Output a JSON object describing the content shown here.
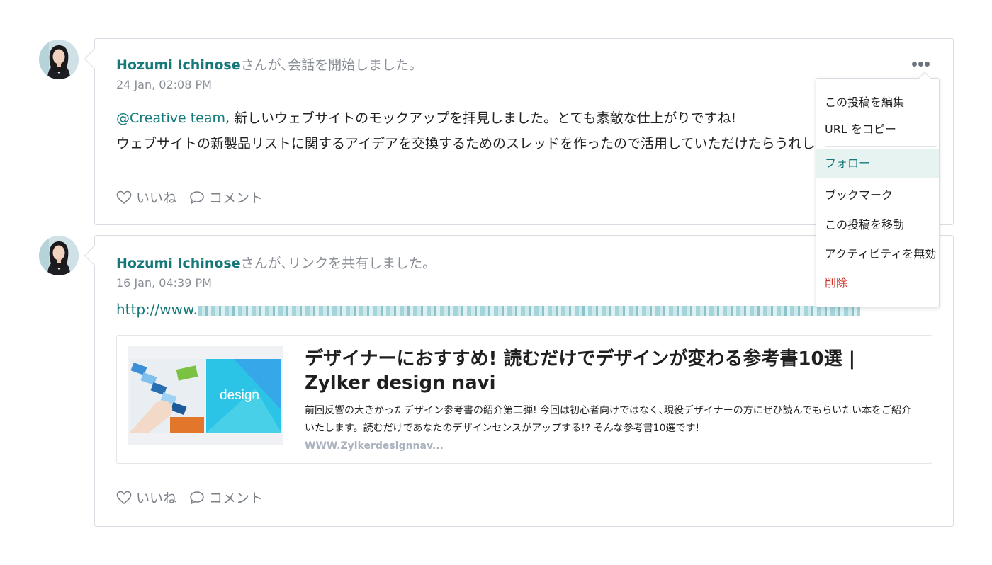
{
  "posts": [
    {
      "author": "Hozumi Ichinose",
      "action": "さんが､会話を開始しました。",
      "time": "24 Jan, 02:08 PM",
      "mention": "@Creative team",
      "line1": ", 新しいウェブサイトのモックアップを拝見しました。とても素敵な仕上がりですね!",
      "line2": "ウェブサイトの新製品リストに関するアイデアを交換するためのスレッドを作ったので活用していただけたらうれしいです。",
      "like_label": "いいね",
      "comment_label": "コメント"
    },
    {
      "author": "Hozumi Ichinose",
      "action": "さんが､リンクを共有しました。",
      "time": "16 Jan, 04:39 PM",
      "link_prefix": "http://www.",
      "preview": {
        "title": "デザイナーにおすすめ! 読むだけでデザインが変わる参考書10選 | Zylker design navi",
        "description": "前回反響の大きかったデザイン参考書の紹介第二弾! 今回は初心者向けではなく､現役デザイナーの方にぜひ読んでもらいたい本をご紹介いたします。読むだけであなたのデザインセンスがアップする!? そんな参考書10選です!",
        "url": "WWW.Zylkerdesignnav...",
        "thumb_label": "design"
      },
      "like_label": "いいね",
      "comment_label": "コメント"
    }
  ],
  "menu": {
    "items": [
      "この投稿を編集",
      "URL をコピー",
      "フォロー",
      "ブックマーク",
      "この投稿を移動",
      "アクティビティを無効",
      "削除"
    ],
    "active_index": 2
  },
  "colors": {
    "accent": "#15797a",
    "danger": "#d0342c",
    "muted": "#8a8f97"
  }
}
